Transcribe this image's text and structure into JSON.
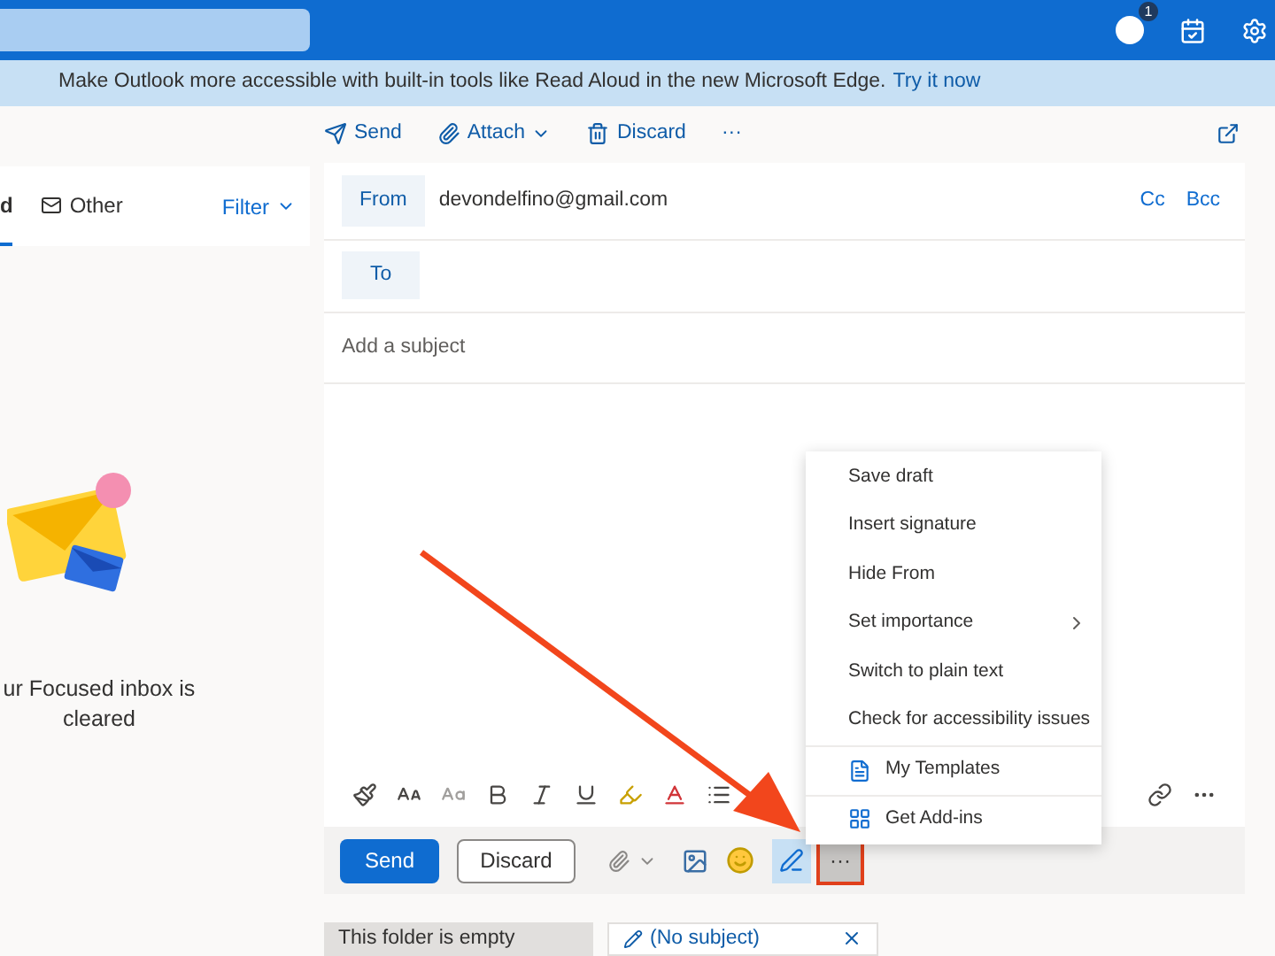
{
  "header": {
    "skype_badge": "1"
  },
  "banner": {
    "text": "Make Outlook more accessible with built-in tools like Read Aloud in the new Microsoft Edge.",
    "link": "Try it now"
  },
  "command_bar": [
    {
      "kind": "send",
      "label": "Send"
    },
    {
      "kind": "attach",
      "label": "Attach"
    },
    {
      "kind": "discard",
      "label": "Discard"
    },
    {
      "kind": "more",
      "label": "···"
    }
  ],
  "list_pane": {
    "tabs": [
      {
        "label": "d",
        "selected": true
      },
      {
        "label": "Other",
        "selected": false
      }
    ],
    "filter": "Filter",
    "empty_message": "ur Focused inbox is cleared"
  },
  "compose": {
    "from_label": "From",
    "from_value": "devondelfino@gmail.com",
    "cc": "Cc",
    "bcc": "Bcc",
    "to_label": "To",
    "subject_placeholder": "Add a subject"
  },
  "menu": [
    {
      "kind": "plain",
      "label": "Save draft"
    },
    {
      "kind": "plain",
      "label": "Insert signature"
    },
    {
      "kind": "plain",
      "label": "Hide From"
    },
    {
      "kind": "submenu",
      "label": "Set importance"
    },
    {
      "kind": "plain",
      "label": "Switch to plain text"
    },
    {
      "kind": "plain",
      "label": "Check for accessibility issues"
    },
    {
      "kind": "templates",
      "label": "My Templates"
    },
    {
      "kind": "addins",
      "label": "Get Add-ins"
    }
  ],
  "actions": {
    "send": "Send",
    "discard": "Discard",
    "more": {
      "label": "···",
      "highlighted": true
    },
    "editor_active": true
  },
  "bottom_tabs": [
    {
      "kind": "folder",
      "label": "This folder is empty"
    },
    {
      "kind": "draft",
      "label": "(No subject)"
    }
  ]
}
